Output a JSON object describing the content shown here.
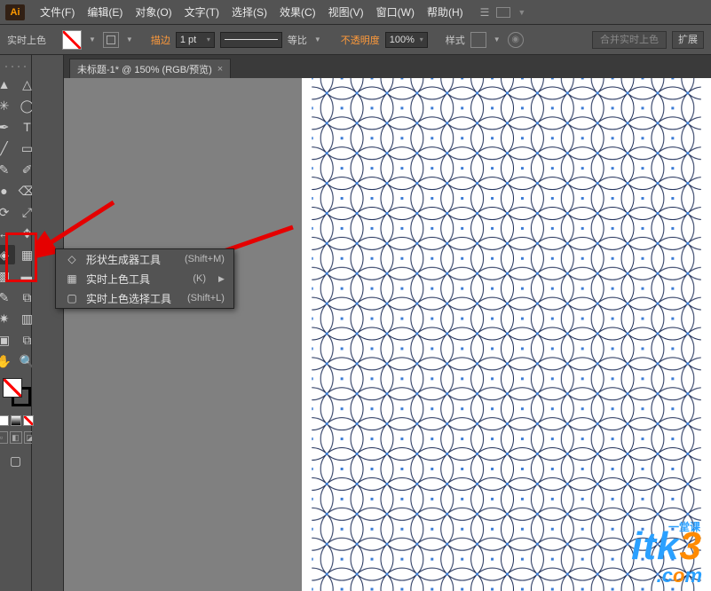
{
  "app": {
    "badge": "Ai"
  },
  "menu": {
    "items": [
      "文件(F)",
      "编辑(E)",
      "对象(O)",
      "文字(T)",
      "选择(S)",
      "效果(C)",
      "视图(V)",
      "窗口(W)",
      "帮助(H)"
    ]
  },
  "options": {
    "tool_name": "实时上色",
    "stroke_label": "描边",
    "stroke_value": "1 pt",
    "ratio_label": "等比",
    "opacity_label": "不透明度",
    "opacity_value": "100%",
    "style_label": "样式",
    "merge_label": "合并实时上色",
    "expand_label": "扩展"
  },
  "tab": {
    "title": "未标题-1* @ 150% (RGB/预览)",
    "close": "×"
  },
  "flyout": {
    "items": [
      {
        "icon": "◇",
        "label": "形状生成器工具",
        "shortcut": "(Shift+M)",
        "sub": false
      },
      {
        "icon": "▦",
        "label": "实时上色工具",
        "shortcut": "(K)",
        "sub": true
      },
      {
        "icon": "▢",
        "label": "实时上色选择工具",
        "shortcut": "(Shift+L)",
        "sub": false
      }
    ]
  },
  "watermark": {
    "line1_a": "itk",
    "line1_b": "3",
    "line2_a": ".c",
    "line2_b": "o",
    "line2_c": "m",
    "zh": "一堂课"
  },
  "icons": {
    "select": "▲",
    "direct": "△",
    "wand": "✳",
    "lasso": "◯",
    "pen": "✒",
    "type": "T",
    "line": "╱",
    "rect": "▭",
    "brush": "✎",
    "pencil": "✐",
    "blob": "●",
    "eraser": "⌫",
    "rotate": "⟳",
    "scale": "⤢",
    "width": "↔",
    "free": "✥",
    "shape": "◈",
    "persp": "▦",
    "mesh": "▩",
    "grad": "▬",
    "eyedrop": "✎",
    "blend": "⧉",
    "symbol": "✷",
    "graph": "▥",
    "artb": "▣",
    "slice": "⧉",
    "hand": "✋",
    "zoom": "🔍"
  }
}
